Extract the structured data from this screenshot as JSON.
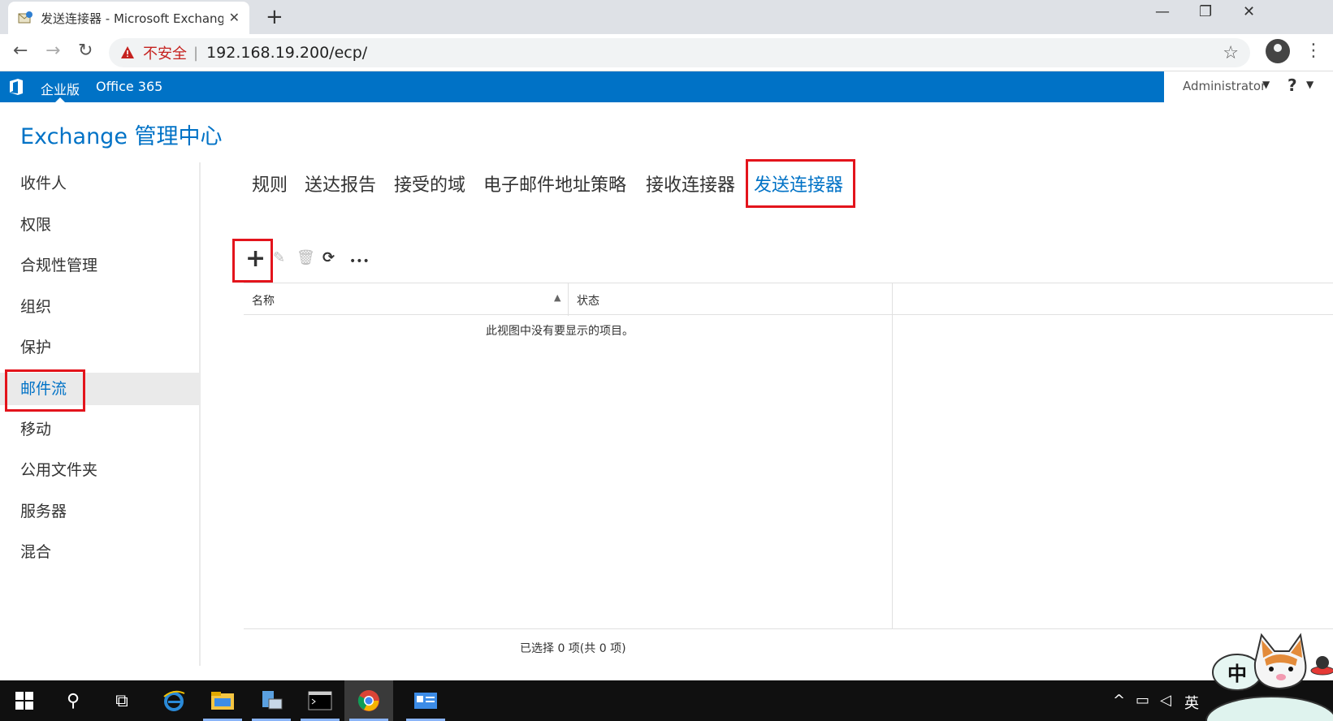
{
  "browser": {
    "tab_title": "发送连接器 - Microsoft Exchange",
    "close_glyph": "✕",
    "newtab_glyph": "+",
    "window_controls": {
      "minimize": "—",
      "restore": "❐",
      "close": "✕"
    },
    "nav": {
      "back": "←",
      "forward": "→",
      "reload": "↻"
    },
    "insecure_label": "不安全",
    "separator": "|",
    "url": "192.168.19.200/ecp/",
    "star_glyph": "☆",
    "menu_glyph": "⋮"
  },
  "o365": {
    "edition": "企业版",
    "office": "Office 365",
    "user": "Administrator",
    "dropdown_glyph": "▼",
    "help_glyph": "?",
    "brand_color": "#0072c6"
  },
  "eac": {
    "title": "Exchange 管理中心",
    "left_nav": [
      {
        "label": "收件人"
      },
      {
        "label": "权限"
      },
      {
        "label": "合规性管理"
      },
      {
        "label": "组织"
      },
      {
        "label": "保护"
      },
      {
        "label": "邮件流",
        "active": true
      },
      {
        "label": "移动"
      },
      {
        "label": "公用文件夹"
      },
      {
        "label": "服务器"
      },
      {
        "label": "混合"
      }
    ],
    "sub_nav": [
      {
        "label": "规则"
      },
      {
        "label": "送达报告"
      },
      {
        "label": "接受的域"
      },
      {
        "label": "电子邮件地址策略"
      },
      {
        "label": "接收连接器"
      },
      {
        "label": "发送连接器",
        "active": true
      }
    ],
    "toolbar": {
      "add_glyph": "+",
      "edit_glyph": "✎",
      "delete_glyph": "🗑",
      "refresh_glyph": "⟳",
      "more_glyph": "•••"
    },
    "grid": {
      "columns": [
        "名称",
        "状态"
      ],
      "sort_glyph": "▲",
      "empty_message": "此视图中没有要显示的项目。",
      "selection_status": "已选择 0 项(共 0 项)"
    }
  },
  "taskbar": {
    "search_glyph": "⚲",
    "taskview_glyph": "⧉",
    "tray": {
      "chevron": "^",
      "ime": "中",
      "lang": "英"
    }
  }
}
